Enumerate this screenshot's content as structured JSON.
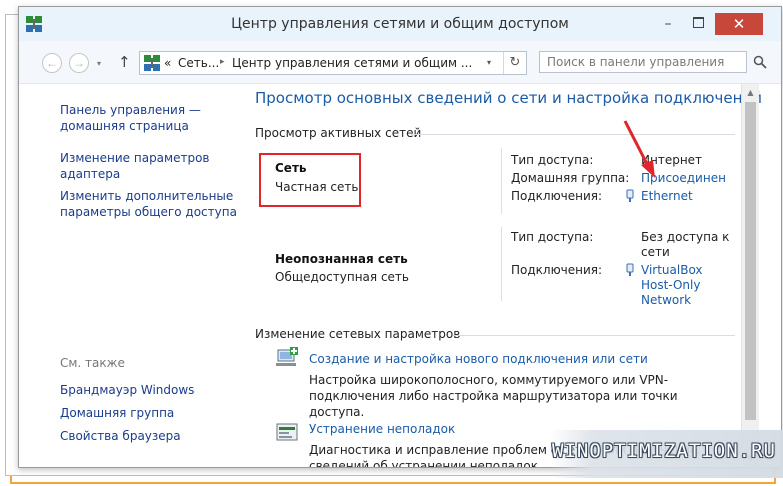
{
  "window": {
    "title": "Центр управления сетями и общим доступом",
    "minimize_label": "–",
    "close_label": "✕"
  },
  "address": {
    "back_label": "←",
    "forward_label": "→",
    "recent_label": "▾",
    "up_label": "↑",
    "crumb_prefix": "«",
    "crumb_sep": "▸",
    "crumbs": [
      "Сеть...",
      "Центр управления сетями и общим ..."
    ],
    "dropdown_label": "▾",
    "refresh_label": "↻",
    "search_placeholder": "Поиск в панели управления"
  },
  "sidebar": {
    "links": [
      "Панель управления — домашняя страница",
      "Изменение параметров адаптера",
      "Изменить дополнительные параметры общего доступа"
    ],
    "see_also_label": "См. также",
    "see_also": [
      "Брандмауэр Windows",
      "Домашняя группа",
      "Свойства браузера"
    ]
  },
  "main": {
    "heading": "Просмотр основных сведений о сети и настройка подключений",
    "active_networks_label": "Просмотр активных сетей",
    "networks": [
      {
        "name": "Сеть",
        "type": "Частная сеть",
        "access_label": "Тип доступа:",
        "access_value": "Интернет",
        "homegroup_label": "Домашняя группа:",
        "homegroup_value": "Присоединен",
        "connections_label": "Подключения:",
        "connection": "Ethernet"
      },
      {
        "name": "Неопознанная сеть",
        "type": "Общедоступная сеть",
        "access_label": "Тип доступа:",
        "access_value": "Без доступа к сети",
        "connections_label": "Подключения:",
        "connection": "VirtualBox Host-Only Network"
      }
    ],
    "change_settings_label": "Изменение сетевых параметров",
    "tasks": [
      {
        "link": "Создание и настройка нового подключения или сети",
        "description": "Настройка широкополосного, коммутируемого или VPN-подключения либо настройка маршрутизатора или точки доступа."
      },
      {
        "link": "Устранение неполадок",
        "description": "Диагностика и исправление проблем с сетью или получение сведений об устранении неполадок."
      }
    ]
  },
  "scrollbar": {
    "up_label": "▲",
    "down_label": "▼"
  },
  "watermark": "WINOPTIMIZATION.RU",
  "colors": {
    "link": "#1b5ba8",
    "sidebar_link": "#1b3c8c",
    "highlight_border": "#e0262b",
    "close_button": "#c7473b",
    "orange_frame": "#f4a53a"
  }
}
